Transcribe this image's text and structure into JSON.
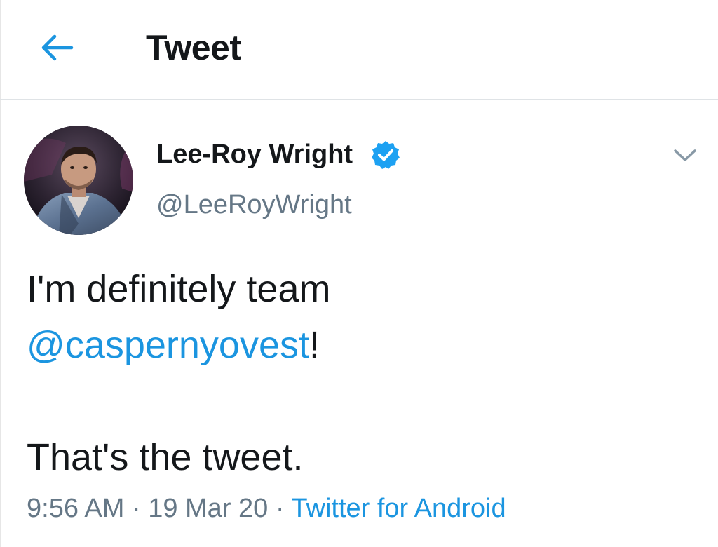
{
  "header": {
    "back_icon": "arrow-left-icon",
    "title": "Tweet"
  },
  "tweet": {
    "author": {
      "name": "Lee-Roy Wright",
      "handle": "@LeeRoyWright",
      "verified_icon": "verified-badge-icon",
      "avatar": "avatar-photo"
    },
    "menu_icon": "chevron-down-icon",
    "text": {
      "line1": "I'm definitely team",
      "mention": "@caspernyovest",
      "after_mention": "!",
      "line3": "That's the tweet."
    },
    "meta": {
      "time": "9:56 AM",
      "separator": "·",
      "date": "19 Mar 20",
      "source": "Twitter for Android"
    }
  },
  "colors": {
    "accent": "#1b95e0",
    "text": "#14171a",
    "muted": "#657786",
    "divider": "#dfe3e6"
  }
}
